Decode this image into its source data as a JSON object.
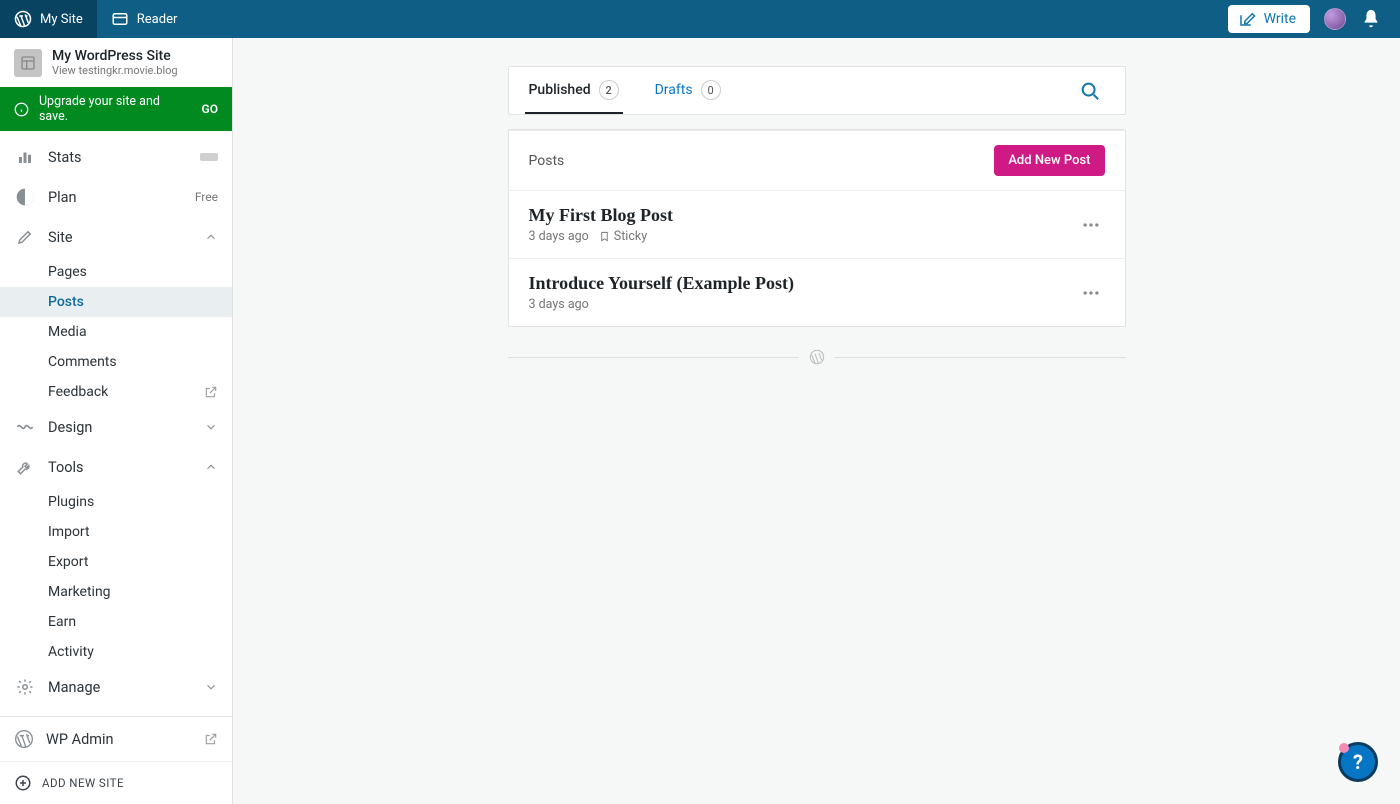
{
  "topbar": {
    "mysite": "My Site",
    "reader": "Reader",
    "write": "Write"
  },
  "siteCard": {
    "title": "My WordPress Site",
    "urlPrefix": "View ",
    "url": "testingkr.movie.blog"
  },
  "upgrade": {
    "text": "Upgrade your site and save.",
    "go": "GO"
  },
  "sidebar": {
    "stats": "Stats",
    "plan": "Plan",
    "plan_badge": "Free",
    "site": "Site",
    "site_items": [
      "Pages",
      "Posts",
      "Media",
      "Comments",
      "Feedback"
    ],
    "design": "Design",
    "tools": "Tools",
    "tools_items": [
      "Plugins",
      "Import",
      "Export",
      "Marketing",
      "Earn",
      "Activity"
    ],
    "manage": "Manage",
    "wpadmin": "WP Admin",
    "addsite": "ADD NEW SITE"
  },
  "tabs": {
    "published": "Published",
    "published_count": "2",
    "drafts": "Drafts",
    "drafts_count": "0"
  },
  "postsHeader": "Posts",
  "addNew": "Add New Post",
  "posts": [
    {
      "title": "My First Blog Post",
      "meta": "3 days ago",
      "sticky": "Sticky"
    },
    {
      "title": "Introduce Yourself (Example Post)",
      "meta": "3 days ago",
      "sticky": ""
    }
  ],
  "help": "?"
}
